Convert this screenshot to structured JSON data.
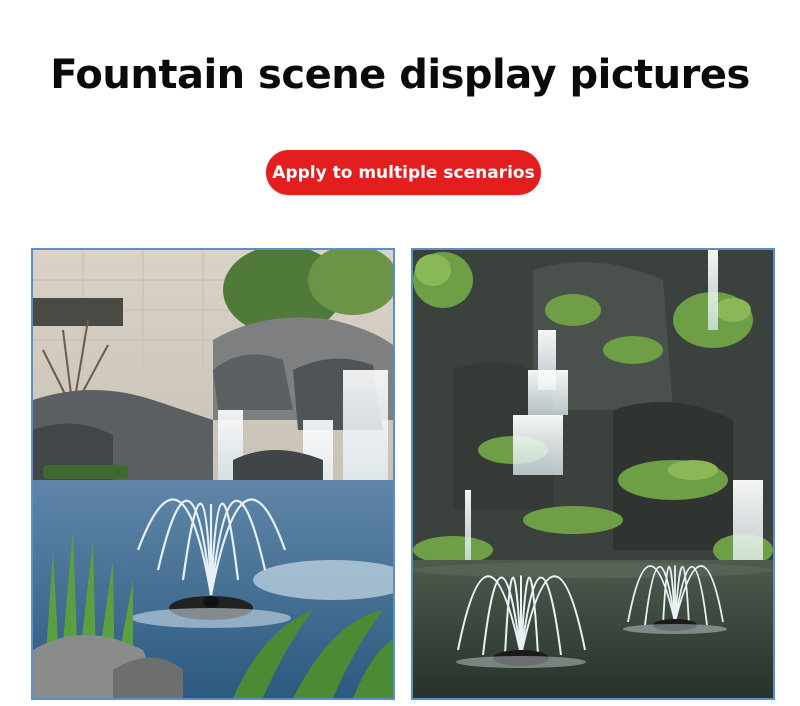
{
  "header": {
    "title": "Fountain scene display pictures",
    "badge_label": "Apply to multiple scenarios",
    "badge_color": "#e31e1e"
  },
  "photos": [
    {
      "name": "garden-waterfall-fountain-photo"
    },
    {
      "name": "rock-waterfall-pond-fountains-photo"
    }
  ],
  "colors": {
    "frame_border": "#5b8fc7"
  }
}
